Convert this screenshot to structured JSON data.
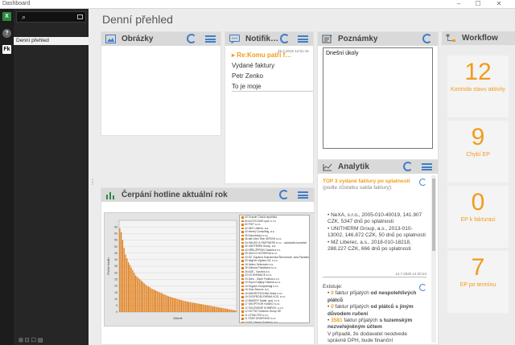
{
  "window": {
    "title": "Dashboard"
  },
  "sidebar": {
    "tree_root": "☰",
    "items": [
      {
        "label": "Denní přehled",
        "selected": true
      }
    ]
  },
  "leftbar": {
    "items": [
      "excel-icon",
      "help-icon",
      "Fk"
    ]
  },
  "page": {
    "title": "Denní přehled"
  },
  "panels": {
    "obrazky": {
      "title": "Obrázky"
    },
    "notifikace": {
      "title": "Notifik…",
      "items": [
        {
          "text": "Re:Komu patří f…",
          "active": true
        },
        {
          "text": "Vydané faktury"
        },
        {
          "text": "Petr Zenko"
        },
        {
          "text": "To je moje"
        }
      ],
      "date": "15.2.2016 12:51:16"
    },
    "poznamky": {
      "title": "Poznámky",
      "note": "Dnešní úkoly"
    },
    "workflow": {
      "title": "Workflow",
      "items": [
        {
          "number": "12",
          "label": "Kontrola stavu aktivity"
        },
        {
          "number": "9",
          "label": "Chybí EP"
        },
        {
          "number": "0",
          "label": "EP k fakturaci"
        },
        {
          "number": "7",
          "label": "EP po termínu"
        }
      ]
    },
    "analytik": {
      "title": "Analytik",
      "block1": {
        "heading_hl": "TOP 3 vydané faktury po splatnosti",
        "heading_rest": " (podle zůstatku salda faktury):",
        "items": [
          "NeXA, s.r.o., 2005-010-40019, 141.907 CZK, 5347 dnů po splatnosti",
          "UNITHERM Group, a.s., 2013-010-13002, 146.872 CZK, 50 dnů po splatnosti",
          "MZ Liberec, a.s., 2018-010-18218, 288.227 CZK, 666 dnů po splatnosti"
        ],
        "date": "14.7.2020 14:20:24"
      },
      "block2": {
        "intro": "Existuje:",
        "lines": [
          {
            "count": "0",
            "text_a": " faktur přijatých ",
            "bold": "od nespolehlivých plátců",
            "text_b": ""
          },
          {
            "count": "0",
            "text_a": " faktur přijatých ",
            "bold": "od plátců s jiným důvodem ručení",
            "text_b": ""
          },
          {
            "count": "3581",
            "text_a": " faktur přijatých ",
            "bold": "s tuzemským nezveřejněným účtem",
            "text_b": ""
          }
        ],
        "footer": "V případě, že dodavatel neodvede správně DPH, bude finanční"
      }
    },
    "cerpani": {
      "title": "Čerpání hotline aktuální rok"
    }
  },
  "chart_data": {
    "type": "bar",
    "title": "",
    "xlabel": "Klienti",
    "ylabel": "Počet hodin",
    "ylim": [
      0,
      70
    ],
    "yticks": [
      0,
      5,
      10,
      15,
      20,
      25,
      30,
      35,
      40,
      45,
      50,
      55,
      60,
      65
    ],
    "bar_color": "#e07a12",
    "values": [
      64,
      61,
      55,
      49,
      44,
      41,
      38,
      36,
      34,
      32,
      30,
      28,
      27,
      26,
      25,
      24,
      23,
      22,
      21,
      20,
      19.5,
      19,
      18,
      17.5,
      17,
      16.5,
      16,
      15.5,
      15,
      14.5,
      14,
      13.5,
      13,
      12.5,
      12,
      11.7,
      11.4,
      11,
      10.7,
      10.4,
      10,
      9.7,
      9.4,
      9.1,
      8.8,
      8.5,
      8.2,
      8,
      7.8,
      7.6,
      7.4,
      7.2,
      7,
      6.8,
      6.6,
      6.4,
      6.2,
      6,
      5.8,
      5.6,
      5.4,
      5.2,
      5,
      4.8,
      4.6,
      4.4,
      4.2,
      4,
      3.8,
      3.6,
      3.4,
      3.2,
      3,
      2.8,
      2.6,
      2.4,
      2.2,
      2,
      1.8,
      1.6,
      1.4,
      1.2
    ],
    "legend": [
      "40 Ovarde Česká republika",
      "60 AUTOCOMS spol. s r.o.",
      "60 POP, s.r.o.",
      "42 NEX Liberec, a.s.",
      "40 Interej Consulting, a.s.",
      "39 Exportstory s.r.o.",
      "46 adu Med Tech SERVIS s.r.o.",
      "34 HNUSO & PARTNERS s.r.o. - advokátní kancelář",
      "40 UNITHERM Group, a.s.",
      "40 KŘELŽPROKI Nadcia s.r.o.",
      "25 VACCO SCREENA s.r.o.",
      "20 SŽ. Zupárna Súkromníka Šimonovich Jára Pardubice",
      "33 VagHm Výpisa-OG, s.r.o.",
      "18 Vedec Sebrování o.s.",
      "26 Zdenka Podstavná s.r.o.",
      "25 ADE - Výrobní a.s.",
      "23 KS ENHANCE s.r.o.",
      "19 Ziem - Ziyoh Frolikus s.r.o.",
      "19 Ziyon Krajský Ostrava s.r.o.",
      "19 Rogrich Kompdelagi s.r.o.",
      "16 Oslo Zárucní, a.s.",
      "16 MAKROTECHNA Vesta s.r.o.",
      "16 SVOPRODI-FARMA VOS, s.r.o.",
      "12 BAKERY Sadel, spol. s r.o.",
      "17 SHOPTHOR HUNKO s.r.o.",
      "12 SOUČASNÉ KOMÍRCE, s.r.o.",
      "12 KUTTA Tronteurs Group SE",
      "11 UTSULTED s.r.o.",
      "11 STAR GRAPHIOS s.r.o.",
      "10 MZ Liberec Systema, a.s.",
      "10 SENO Přidestrial Invest s.r.o.",
      "10 BAR Plastic s.r.o.",
      "10 SOLITRON s.r.o.",
      "9 UNITHERM Group, a.s.",
      "9 NEX Česká republika",
      "9 Nikeli s.r.o.",
      "7 ada nedostřeze HomeWA Bosoft Inform: s.r.o."
    ]
  },
  "colors": {
    "accent_orange": "#f29b1b",
    "accent_blue": "#3f7ec7",
    "dark_bg": "#262626"
  }
}
